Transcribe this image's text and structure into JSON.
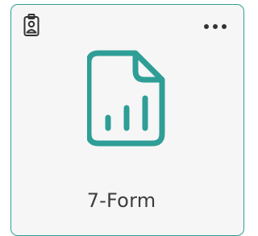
{
  "card": {
    "label": "7-Form",
    "icons": {
      "badge": "id-badge-icon",
      "menu": "more-options-icon",
      "file": "file-chart-icon"
    },
    "colors": {
      "accent": "#2e9e96",
      "background": "#f6f6f6",
      "text": "#3d3d3d"
    }
  }
}
